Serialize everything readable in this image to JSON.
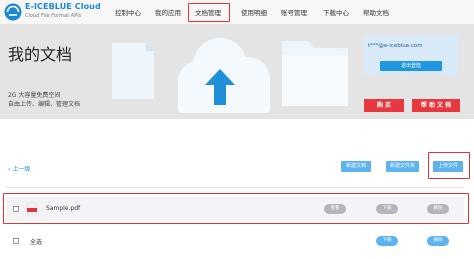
{
  "logo": {
    "title": "E-ICEBLUE Cloud",
    "subtitle": "Cloud File Format APIs"
  },
  "nav": [
    {
      "label": "控制中心"
    },
    {
      "label": "我的应用"
    },
    {
      "label": "文档管理"
    },
    {
      "label": "使用明细"
    },
    {
      "label": "账号管理"
    },
    {
      "label": "下载中心"
    },
    {
      "label": "帮助文档"
    }
  ],
  "banner": {
    "title": "我的文档",
    "storage_line": "2G 大容量免费空间",
    "feature_line": "自由上传、编辑、管理文档"
  },
  "user": {
    "email": "t***@e-iceblue.com",
    "logout": "退出登陆"
  },
  "actions": {
    "buy": "购 买",
    "help": "帮 助 文 档"
  },
  "toolbar": {
    "back": "上一级",
    "new_doc": "新建文档",
    "new_folder": "新建文件夹",
    "upload": "上传文件"
  },
  "files": [
    {
      "name": "Sample.pdf",
      "view": "查看",
      "download": "下载",
      "delete": "删除"
    }
  ],
  "select_all": {
    "label": "全选",
    "download": "下载",
    "delete": "删除"
  },
  "colors": {
    "accent": "#1a88d6",
    "highlight": "#e0333a",
    "button": "#5cb3ee",
    "red_action": "#e8383f"
  }
}
